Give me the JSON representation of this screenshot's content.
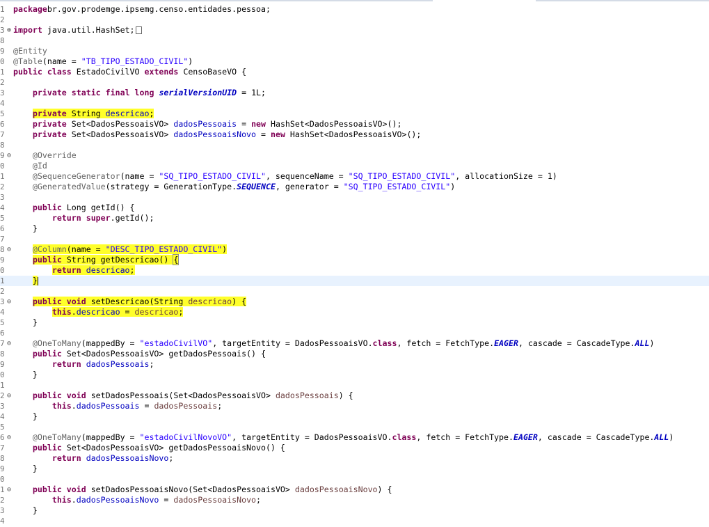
{
  "editor": {
    "lines": [
      {
        "ln": "1",
        "fold": "",
        "current": false,
        "tokens": [
          [
            "kw",
            "package"
          ],
          [
            "",
            "br.gov.prodemge.ipsemg.censo.entidades.pessoa;"
          ]
        ]
      },
      {
        "ln": "2",
        "fold": "",
        "current": false,
        "tokens": []
      },
      {
        "ln": "3",
        "fold": "plus",
        "current": false,
        "tokens": [
          [
            "kw",
            "import"
          ],
          [
            "",
            " java.util.HashSet;"
          ]
        ],
        "trailing_box": true
      },
      {
        "ln": "8",
        "fold": "",
        "current": false,
        "tokens": []
      },
      {
        "ln": "9",
        "fold": "",
        "current": false,
        "tokens": [
          [
            "ann",
            "@Entity"
          ]
        ]
      },
      {
        "ln": "0",
        "fold": "",
        "current": false,
        "tokens": [
          [
            "ann",
            "@Table"
          ],
          [
            "",
            "(name = "
          ],
          [
            "str",
            "\"TB_TIPO_ESTADO_CIVIL\""
          ],
          [
            "",
            ")"
          ]
        ]
      },
      {
        "ln": "1",
        "fold": "",
        "current": false,
        "tokens": [
          [
            "kw",
            "public"
          ],
          [
            "",
            " "
          ],
          [
            "kw",
            "class"
          ],
          [
            "",
            " EstadoCivilVO "
          ],
          [
            "kw",
            "extends"
          ],
          [
            "",
            " CensoBaseVO {"
          ]
        ]
      },
      {
        "ln": "2",
        "fold": "",
        "current": false,
        "tokens": []
      },
      {
        "ln": "3",
        "fold": "",
        "current": false,
        "tokens": [
          [
            "",
            "    "
          ],
          [
            "kw",
            "private"
          ],
          [
            "",
            " "
          ],
          [
            "kw",
            "static"
          ],
          [
            "",
            " "
          ],
          [
            "kw",
            "final"
          ],
          [
            "",
            " "
          ],
          [
            "kw",
            "long"
          ],
          [
            "",
            " "
          ],
          [
            "sfld",
            "serialVersionUID"
          ],
          [
            "",
            " = 1L;"
          ]
        ]
      },
      {
        "ln": "4",
        "fold": "",
        "current": false,
        "tokens": []
      },
      {
        "ln": "5",
        "fold": "",
        "current": false,
        "tokens": [
          [
            "",
            "    "
          ],
          [
            "kw hl",
            "private"
          ],
          [
            "hl",
            " String "
          ],
          [
            "fld hl",
            "descricao"
          ],
          [
            "hl",
            ";"
          ]
        ]
      },
      {
        "ln": "6",
        "fold": "",
        "current": false,
        "tokens": [
          [
            "",
            "    "
          ],
          [
            "kw",
            "private"
          ],
          [
            "",
            " Set<DadosPessoaisVO> "
          ],
          [
            "fld",
            "dadosPessoais"
          ],
          [
            "",
            " = "
          ],
          [
            "kw",
            "new"
          ],
          [
            "",
            " HashSet<DadosPessoaisVO>();"
          ]
        ]
      },
      {
        "ln": "7",
        "fold": "",
        "current": false,
        "tokens": [
          [
            "",
            "    "
          ],
          [
            "kw",
            "private"
          ],
          [
            "",
            " Set<DadosPessoaisVO> "
          ],
          [
            "fld",
            "dadosPessoaisNovo"
          ],
          [
            "",
            " = "
          ],
          [
            "kw",
            "new"
          ],
          [
            "",
            " HashSet<DadosPessoaisVO>();"
          ]
        ]
      },
      {
        "ln": "8",
        "fold": "",
        "current": false,
        "tokens": []
      },
      {
        "ln": "9",
        "fold": "minus",
        "current": false,
        "tokens": [
          [
            "",
            "    "
          ],
          [
            "ann",
            "@Override"
          ]
        ]
      },
      {
        "ln": "0",
        "fold": "",
        "current": false,
        "tokens": [
          [
            "",
            "    "
          ],
          [
            "ann",
            "@Id"
          ]
        ]
      },
      {
        "ln": "1",
        "fold": "",
        "current": false,
        "tokens": [
          [
            "",
            "    "
          ],
          [
            "ann",
            "@SequenceGenerator"
          ],
          [
            "",
            "(name = "
          ],
          [
            "str",
            "\"SQ_TIPO_ESTADO_CIVIL\""
          ],
          [
            "",
            ", sequenceName = "
          ],
          [
            "str",
            "\"SQ_TIPO_ESTADO_CIVIL\""
          ],
          [
            "",
            ", allocationSize = 1)"
          ]
        ]
      },
      {
        "ln": "2",
        "fold": "",
        "current": false,
        "tokens": [
          [
            "",
            "    "
          ],
          [
            "ann",
            "@GeneratedValue"
          ],
          [
            "",
            "(strategy = GenerationType."
          ],
          [
            "econst",
            "SEQUENCE"
          ],
          [
            "",
            ", generator = "
          ],
          [
            "str",
            "\"SQ_TIPO_ESTADO_CIVIL\""
          ],
          [
            "",
            ")"
          ]
        ]
      },
      {
        "ln": "3",
        "fold": "",
        "current": false,
        "tokens": []
      },
      {
        "ln": "4",
        "fold": "",
        "current": false,
        "tokens": [
          [
            "",
            "    "
          ],
          [
            "kw",
            "public"
          ],
          [
            "",
            " Long getId() {"
          ]
        ]
      },
      {
        "ln": "5",
        "fold": "",
        "current": false,
        "tokens": [
          [
            "",
            "        "
          ],
          [
            "kw",
            "return"
          ],
          [
            "",
            " "
          ],
          [
            "kw",
            "super"
          ],
          [
            "",
            ".getId();"
          ]
        ]
      },
      {
        "ln": "6",
        "fold": "",
        "current": false,
        "tokens": [
          [
            "",
            "    }"
          ]
        ]
      },
      {
        "ln": "7",
        "fold": "",
        "current": false,
        "tokens": []
      },
      {
        "ln": "8",
        "fold": "minus",
        "current": false,
        "tokens": [
          [
            "",
            "    "
          ],
          [
            "ann hl",
            "@Column"
          ],
          [
            "hl",
            "(name = "
          ],
          [
            "str hl",
            "\"DESC_TIPO_ESTADO_CIVIL\""
          ],
          [
            "hl",
            ")"
          ]
        ]
      },
      {
        "ln": "9",
        "fold": "",
        "current": false,
        "tokens": [
          [
            "",
            "    "
          ],
          [
            "kw hl",
            "public"
          ],
          [
            "hl",
            " String getDescricao() "
          ],
          [
            "hl bracket-box",
            "{"
          ]
        ]
      },
      {
        "ln": "0",
        "fold": "",
        "current": false,
        "tokens": [
          [
            "",
            "        "
          ],
          [
            "kw hl",
            "return"
          ],
          [
            "hl",
            " "
          ],
          [
            "fld hl",
            "descricao"
          ],
          [
            "hl",
            ";"
          ]
        ]
      },
      {
        "ln": "1",
        "fold": "",
        "current": true,
        "tokens": [
          [
            "",
            "    "
          ],
          [
            "hl",
            "}"
          ]
        ],
        "caret": true
      },
      {
        "ln": "2",
        "fold": "",
        "current": false,
        "tokens": []
      },
      {
        "ln": "3",
        "fold": "minus",
        "current": false,
        "tokens": [
          [
            "",
            "    "
          ],
          [
            "kw hl",
            "public"
          ],
          [
            "hl",
            " "
          ],
          [
            "kw hl",
            "void"
          ],
          [
            "hl",
            " setDescricao(String "
          ],
          [
            "param hl",
            "descricao"
          ],
          [
            "hl",
            ") {"
          ]
        ]
      },
      {
        "ln": "4",
        "fold": "",
        "current": false,
        "tokens": [
          [
            "",
            "        "
          ],
          [
            "kw hl",
            "this"
          ],
          [
            "hl",
            "."
          ],
          [
            "fld hl",
            "descricao"
          ],
          [
            "hl",
            " = "
          ],
          [
            "param hl",
            "descricao"
          ],
          [
            "hl",
            ";"
          ]
        ]
      },
      {
        "ln": "5",
        "fold": "",
        "current": false,
        "tokens": [
          [
            "",
            "    }"
          ]
        ]
      },
      {
        "ln": "6",
        "fold": "",
        "current": false,
        "tokens": []
      },
      {
        "ln": "7",
        "fold": "minus",
        "current": false,
        "tokens": [
          [
            "",
            "    "
          ],
          [
            "ann",
            "@OneToMany"
          ],
          [
            "",
            "(mappedBy = "
          ],
          [
            "str",
            "\"estadoCivilVO\""
          ],
          [
            "",
            ", targetEntity = DadosPessoaisVO."
          ],
          [
            "kw",
            "class"
          ],
          [
            "",
            ", fetch = FetchType."
          ],
          [
            "econst",
            "EAGER"
          ],
          [
            "",
            ", cascade = CascadeType."
          ],
          [
            "econst",
            "ALL"
          ],
          [
            "",
            ")"
          ]
        ]
      },
      {
        "ln": "8",
        "fold": "",
        "current": false,
        "tokens": [
          [
            "",
            "    "
          ],
          [
            "kw",
            "public"
          ],
          [
            "",
            " Set<DadosPessoaisVO> getDadosPessoais() {"
          ]
        ]
      },
      {
        "ln": "9",
        "fold": "",
        "current": false,
        "tokens": [
          [
            "",
            "        "
          ],
          [
            "kw",
            "return"
          ],
          [
            "",
            " "
          ],
          [
            "fld",
            "dadosPessoais"
          ],
          [
            "",
            ";"
          ]
        ]
      },
      {
        "ln": "0",
        "fold": "",
        "current": false,
        "tokens": [
          [
            "",
            "    }"
          ]
        ]
      },
      {
        "ln": "1",
        "fold": "",
        "current": false,
        "tokens": []
      },
      {
        "ln": "2",
        "fold": "minus",
        "current": false,
        "tokens": [
          [
            "",
            "    "
          ],
          [
            "kw",
            "public"
          ],
          [
            "",
            " "
          ],
          [
            "kw",
            "void"
          ],
          [
            "",
            " setDadosPessoais(Set<DadosPessoaisVO> "
          ],
          [
            "param",
            "dadosPessoais"
          ],
          [
            "",
            ") {"
          ]
        ]
      },
      {
        "ln": "3",
        "fold": "",
        "current": false,
        "tokens": [
          [
            "",
            "        "
          ],
          [
            "kw",
            "this"
          ],
          [
            "",
            "."
          ],
          [
            "fld",
            "dadosPessoais"
          ],
          [
            "",
            " = "
          ],
          [
            "param",
            "dadosPessoais"
          ],
          [
            "",
            ";"
          ]
        ]
      },
      {
        "ln": "4",
        "fold": "",
        "current": false,
        "tokens": [
          [
            "",
            "    }"
          ]
        ]
      },
      {
        "ln": "5",
        "fold": "",
        "current": false,
        "tokens": []
      },
      {
        "ln": "6",
        "fold": "minus",
        "current": false,
        "tokens": [
          [
            "",
            "    "
          ],
          [
            "ann",
            "@OneToMany"
          ],
          [
            "",
            "(mappedBy = "
          ],
          [
            "str",
            "\"estadoCivilNovoVO\""
          ],
          [
            "",
            ", targetEntity = DadosPessoaisVO."
          ],
          [
            "kw",
            "class"
          ],
          [
            "",
            ", fetch = FetchType."
          ],
          [
            "econst",
            "EAGER"
          ],
          [
            "",
            ", cascade = CascadeType."
          ],
          [
            "econst",
            "ALL"
          ],
          [
            "",
            ")"
          ]
        ]
      },
      {
        "ln": "7",
        "fold": "",
        "current": false,
        "tokens": [
          [
            "",
            "    "
          ],
          [
            "kw",
            "public"
          ],
          [
            "",
            " Set<DadosPessoaisVO> getDadosPessoaisNovo() {"
          ]
        ]
      },
      {
        "ln": "8",
        "fold": "",
        "current": false,
        "tokens": [
          [
            "",
            "        "
          ],
          [
            "kw",
            "return"
          ],
          [
            "",
            " "
          ],
          [
            "fld",
            "dadosPessoaisNovo"
          ],
          [
            "",
            ";"
          ]
        ]
      },
      {
        "ln": "9",
        "fold": "",
        "current": false,
        "tokens": [
          [
            "",
            "    }"
          ]
        ]
      },
      {
        "ln": "0",
        "fold": "",
        "current": false,
        "tokens": []
      },
      {
        "ln": "1",
        "fold": "minus",
        "current": false,
        "tokens": [
          [
            "",
            "    "
          ],
          [
            "kw",
            "public"
          ],
          [
            "",
            " "
          ],
          [
            "kw",
            "void"
          ],
          [
            "",
            " setDadosPessoaisNovo(Set<DadosPessoaisVO> "
          ],
          [
            "param",
            "dadosPessoaisNovo"
          ],
          [
            "",
            ") {"
          ]
        ]
      },
      {
        "ln": "2",
        "fold": "",
        "current": false,
        "tokens": [
          [
            "",
            "        "
          ],
          [
            "kw",
            "this"
          ],
          [
            "",
            "."
          ],
          [
            "fld",
            "dadosPessoaisNovo"
          ],
          [
            "",
            " = "
          ],
          [
            "param",
            "dadosPessoaisNovo"
          ],
          [
            "",
            ";"
          ]
        ]
      },
      {
        "ln": "3",
        "fold": "",
        "current": false,
        "tokens": [
          [
            "",
            "    }"
          ]
        ]
      },
      {
        "ln": "4",
        "fold": "",
        "current": false,
        "tokens": []
      }
    ],
    "fold_glyphs": {
      "plus": "⊕",
      "minus": "⊖"
    }
  },
  "colors": {
    "keyword": "#7f0055",
    "annotation": "#646464",
    "string": "#2a00ff",
    "field": "#0000c0",
    "parameter": "#6a3e3e",
    "highlight": "#ffff2a",
    "current_line": "#e8f2fe"
  }
}
